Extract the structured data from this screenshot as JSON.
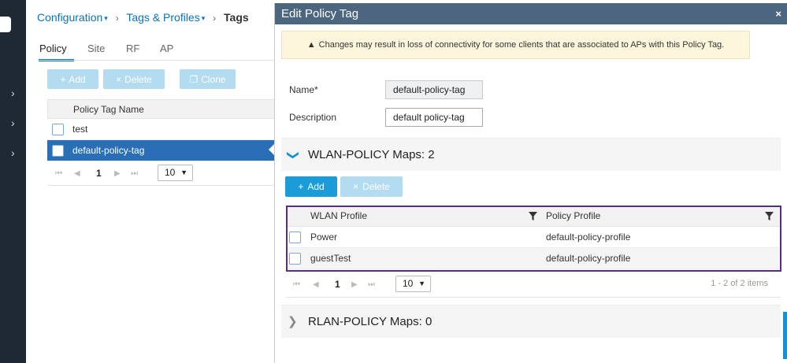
{
  "breadcrumb": {
    "item1": "Configuration",
    "item2": "Tags & Profiles",
    "current": "Tags"
  },
  "tabs": [
    "Policy",
    "Site",
    "RF",
    "AP"
  ],
  "bg_toolbar": {
    "add": "Add",
    "delete": "Delete",
    "clone": "Clone"
  },
  "bg_table": {
    "header": "Policy Tag Name",
    "rows": [
      "test",
      "default-policy-tag"
    ]
  },
  "bg_pager": {
    "page": "1",
    "per_page": "10"
  },
  "modal": {
    "title": "Edit Policy Tag",
    "close": "×",
    "warning": "Changes may result in loss of connectivity for some clients that are associated to APs with this Policy Tag.",
    "name_label": "Name*",
    "name_value": "default-policy-tag",
    "description_label": "Description",
    "description_value": "default policy-tag",
    "wlan_section_title": "WLAN-POLICY Maps: 2",
    "add": "Add",
    "delete": "Delete",
    "table": {
      "col1": "WLAN Profile",
      "col2": "Policy Profile",
      "rows": [
        {
          "wlan": "Power",
          "policy": "default-policy-profile"
        },
        {
          "wlan": "guestTest",
          "policy": "default-policy-profile"
        }
      ]
    },
    "pager": {
      "page": "1",
      "per_page": "10",
      "items": "1 - 2 of 2 items"
    },
    "rlan_section_title": "RLAN-POLICY Maps: 0"
  },
  "colors": {
    "accent": "#0a73b7",
    "header": "#4d6680",
    "selected_row": "#2a6fb5",
    "highlight": "#5a2d82",
    "button": "#1b9cd8"
  }
}
